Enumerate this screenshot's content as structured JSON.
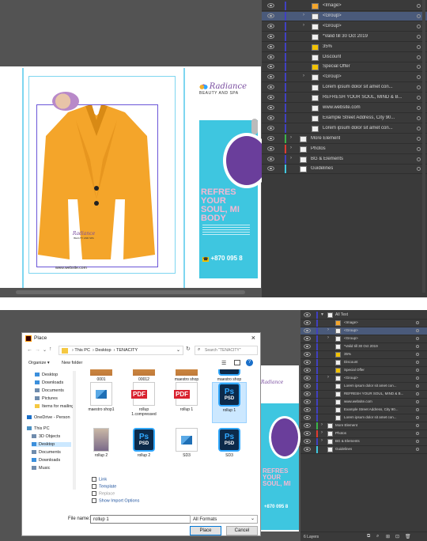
{
  "layers_top": [
    {
      "label": "<Image>",
      "color": "#4040c0",
      "thumb": "img",
      "selected": false,
      "expander": false
    },
    {
      "label": "<Group>",
      "color": "#4040c0",
      "thumb": "doc",
      "selected": true,
      "expander": true
    },
    {
      "label": "<Group>",
      "color": "#4040c0",
      "thumb": "doc",
      "selected": false,
      "expander": true
    },
    {
      "label": "*Valid till 30 Oct 2019",
      "color": "#4040c0",
      "thumb": "doc",
      "selected": false,
      "expander": false
    },
    {
      "label": "35%",
      "color": "#4040c0",
      "thumb": "yellow",
      "selected": false,
      "expander": false
    },
    {
      "label": "Discount",
      "color": "#4040c0",
      "thumb": "doc",
      "selected": false,
      "expander": false
    },
    {
      "label": "Special Offer",
      "color": "#4040c0",
      "thumb": "yellow",
      "selected": false,
      "expander": false
    },
    {
      "label": "<Group>",
      "color": "#4040c0",
      "thumb": "doc",
      "selected": false,
      "expander": true
    },
    {
      "label": "Lorem ipsum dolor sit amet con...",
      "color": "#4040c0",
      "thumb": "doc",
      "selected": false,
      "expander": false
    },
    {
      "label": "REFRESH YOUR SOUL, MIND & B...",
      "color": "#4040c0",
      "thumb": "doc",
      "selected": false,
      "expander": false
    },
    {
      "label": "www.website.com",
      "color": "#4040c0",
      "thumb": "doc",
      "selected": false,
      "expander": false
    },
    {
      "label": "Example Street Address, City 90...",
      "color": "#4040c0",
      "thumb": "doc",
      "selected": false,
      "expander": false
    },
    {
      "label": "Lorem ipsum dolor sit amet con...",
      "color": "#4040c0",
      "thumb": "doc",
      "selected": false,
      "expander": false
    },
    {
      "label": "More Element",
      "color": "#3cb44b",
      "thumb": "doc",
      "selected": false,
      "expander": true
    },
    {
      "label": "Photos",
      "color": "#e03c31",
      "thumb": "doc",
      "selected": false,
      "expander": true
    },
    {
      "label": "BG & Elements",
      "color": "#4040c0",
      "thumb": "doc",
      "selected": false,
      "expander": true
    },
    {
      "label": "Guidelines",
      "color": "#40c8e0",
      "thumb": "white",
      "selected": false,
      "expander": false
    }
  ],
  "layers_bottom_header": "All Text",
  "layers_bottom": [
    {
      "label": "<Image>",
      "selected": false
    },
    {
      "label": "<Group>",
      "selected": true
    },
    {
      "label": "<Group>",
      "selected": false
    },
    {
      "label": "*Valid till 30 Oct 2019",
      "selected": false
    },
    {
      "label": "35%",
      "selected": false
    },
    {
      "label": "Discount",
      "selected": false
    },
    {
      "label": "Special Offer",
      "selected": false
    },
    {
      "label": "<Group>",
      "selected": false
    },
    {
      "label": "Lorem ipsum dolor sit amet con...",
      "selected": false
    },
    {
      "label": "REFRESH YOUR SOUL, MIND & B...",
      "selected": false
    },
    {
      "label": "www.website.com",
      "selected": false
    },
    {
      "label": "Example Street Address, City 90...",
      "selected": false
    },
    {
      "label": "Lorem ipsum dolor sit amet con...",
      "selected": false
    }
  ],
  "layers_bottom_groups": [
    {
      "label": "More Element",
      "color": "#3cb44b"
    },
    {
      "label": "Photos",
      "color": "#e03c31"
    },
    {
      "label": "BG & Elements",
      "color": "#4040c0"
    },
    {
      "label": "Guidelines",
      "color": "#40c8e0"
    }
  ],
  "layers_footer": "6 Layers",
  "artboard": {
    "brand_name": "Radiance",
    "brand_tagline": "BEAUTY AND SPA",
    "website": "www.website.com",
    "headline": "REFRESH YOUR SOUL, MIND & BODY",
    "headline_short_1": "REFRES YOUR",
    "headline_short_2": "SOUL, MI",
    "headline_short_3": "BODY",
    "phone": "+870 095 8",
    "phone_bottom": "+870 095 8"
  },
  "dialog": {
    "title": "Place",
    "breadcrumb": [
      "This PC",
      "Desktop",
      "TENACITY"
    ],
    "search_placeholder": "Search \"TENACITY\"",
    "organize": "Organize ▾",
    "new_folder": "New folder",
    "nav": [
      "Desktop",
      "Downloads",
      "Documents",
      "Pictures",
      "Items for mailing",
      "OneDrive - Person",
      "This PC",
      "3D Objects",
      "Desktop",
      "Documents",
      "Downloads",
      "Music"
    ],
    "files": [
      {
        "name": "0001",
        "type": "partial"
      },
      {
        "name": "00012",
        "type": "partial"
      },
      {
        "name": "maestro shop",
        "type": "partial"
      },
      {
        "name": "maestro shop",
        "type": "psd-partial"
      },
      {
        "name": "maestro shop1",
        "type": "img"
      },
      {
        "name": "rollup 1.compressed",
        "type": "pdf"
      },
      {
        "name": "rollup 1",
        "type": "pdf"
      },
      {
        "name": "rollup 1",
        "type": "psd",
        "selected": true
      },
      {
        "name": "rollup 2",
        "type": "photo"
      },
      {
        "name": "rollup 2",
        "type": "psd"
      },
      {
        "name": "SD3",
        "type": "img"
      },
      {
        "name": "SD3",
        "type": "psd"
      }
    ],
    "options": [
      {
        "label": "Link",
        "enabled": true
      },
      {
        "label": "Template",
        "enabled": true
      },
      {
        "label": "Replace",
        "enabled": false
      },
      {
        "label": "Show Import Options",
        "enabled": true
      }
    ],
    "file_name_label": "File name:",
    "file_name_value": "rollup 1",
    "format": "All Formats",
    "place_button": "Place",
    "cancel_button": "Cancel"
  }
}
